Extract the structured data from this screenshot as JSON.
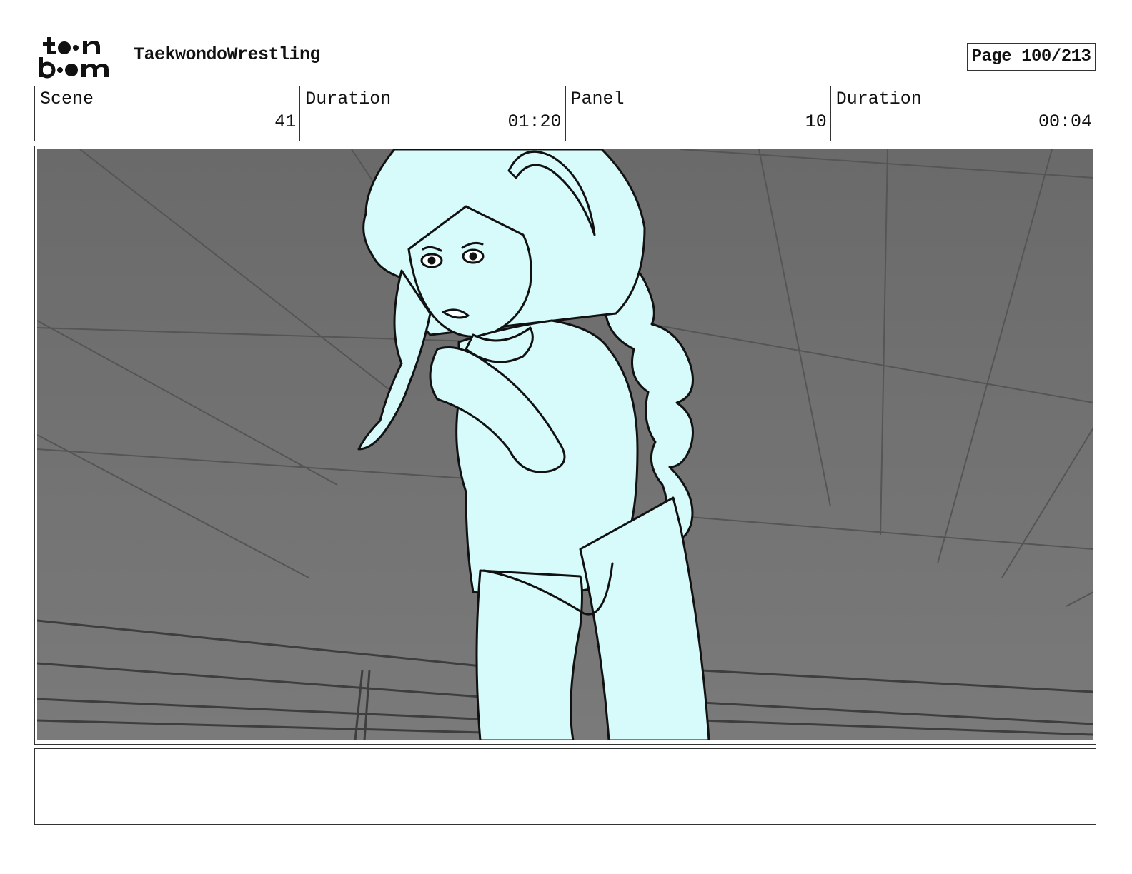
{
  "header": {
    "logo_line1": "to n",
    "logo_line2": "b m",
    "project_title": "TaekwondoWrestling",
    "page_label": "Page 100/213"
  },
  "info": {
    "scene_label": "Scene",
    "scene_value": "41",
    "scene_duration_label": "Duration",
    "scene_duration_value": "01:20",
    "panel_label": "Panel",
    "panel_value": "10",
    "panel_duration_label": "Duration",
    "panel_duration_value": "00:04"
  },
  "panel": {
    "background_color": "#6e6e6e",
    "figure_fill": "#d6fbfa",
    "line_color": "#111111"
  },
  "notes": {
    "text": ""
  }
}
